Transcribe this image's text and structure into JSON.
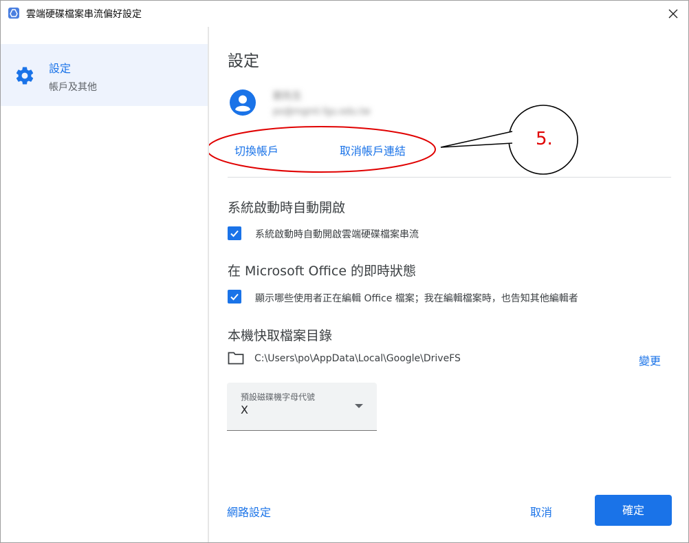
{
  "window": {
    "title": "雲端硬碟檔案串流偏好設定",
    "close_icon": "close-icon"
  },
  "sidebar": {
    "items": [
      {
        "label": "設定",
        "sublabel": "帳戶及其他",
        "icon": "gear-icon",
        "selected": true
      }
    ]
  },
  "main": {
    "title": "設定",
    "account": {
      "name": "劉先生",
      "email": "po@mgmt.fgu.edu.tw",
      "switch_label": "切換帳戶",
      "disconnect_label": "取消帳戶連結"
    },
    "annotation": {
      "label": "5.",
      "color": "#e00000"
    },
    "startup": {
      "title": "系統啟動時自動開啟",
      "checkbox_label": "系統啟動時自動開啟雲端硬碟檔案串流",
      "checked": true
    },
    "office": {
      "title": "在 Microsoft Office 的即時狀態",
      "checkbox_label": "顯示哪些使用者正在編輯 Office 檔案；我在編輯檔案時，也告知其他編輯者",
      "checked": true
    },
    "cache": {
      "title": "本機快取檔案目錄",
      "path": "C:\\Users\\po\\AppData\\Local\\Google\\DriveFS",
      "change_label": "變更"
    },
    "drive_letter": {
      "label": "預設磁碟機字母代號",
      "value": "X"
    },
    "footer": {
      "network_label": "網路設定",
      "cancel_label": "取消",
      "ok_label": "確定"
    }
  },
  "colors": {
    "accent": "#1a73e8",
    "sidebar_selected_bg": "#eef3fd",
    "annotation": "#e00000"
  }
}
